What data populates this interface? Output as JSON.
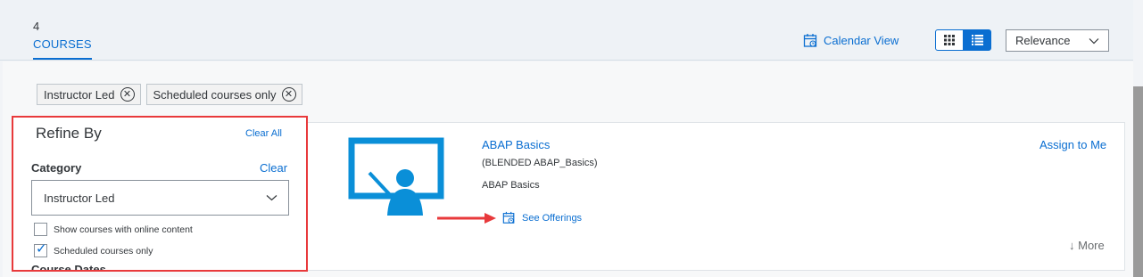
{
  "header": {
    "count": "4",
    "tab_label": "COURSES",
    "calendar_view": "Calendar View",
    "sort_selected": "Relevance",
    "grid_icon": "grid-icon",
    "list_icon": "list-icon"
  },
  "filters": {
    "chips": [
      "Instructor Led",
      "Scheduled courses only"
    ]
  },
  "refine": {
    "title": "Refine By",
    "clear_all": "Clear All",
    "category_label": "Category",
    "category_clear": "Clear",
    "category_value": "Instructor Led",
    "options": [
      {
        "label": "Show courses with online content",
        "checked": false
      },
      {
        "label": "Scheduled courses only",
        "checked": true
      }
    ],
    "dates_label": "Course Dates"
  },
  "course": {
    "title": "ABAP Basics",
    "code": "(BLENDED ABAP_Basics)",
    "description": "ABAP Basics",
    "see_offerings": "See Offerings",
    "assign": "Assign to Me",
    "more": "More"
  },
  "colors": {
    "accent": "#0a6ed1",
    "highlight": "#e8393b",
    "icon": "#0a8fd8"
  }
}
